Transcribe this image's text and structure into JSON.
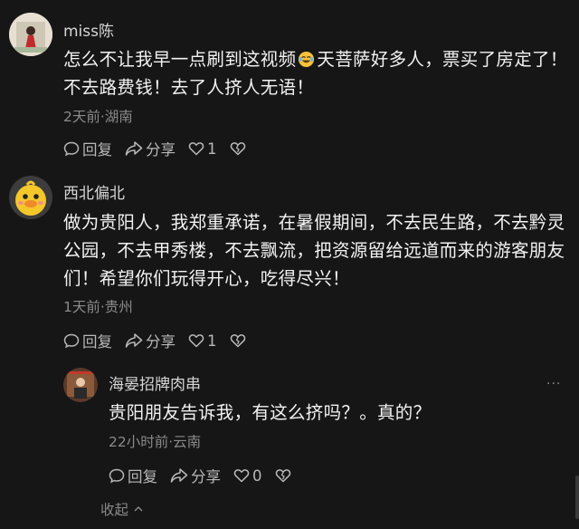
{
  "comments": [
    {
      "user": "miss陈",
      "text_part1": "怎么不让我早一点刷到这视频",
      "emoji": "laughing-crying-emoji",
      "text_part2": "天菩萨好多人，票买了房定了！不去路费钱！去了人挤人无语！",
      "meta": "2天前·湖南",
      "reply_label": "回复",
      "share_label": "分享",
      "likes": "1"
    },
    {
      "user": "西北偏北",
      "text": "做为贵阳人，我郑重承诺，在暑假期间，不去民生路，不去黔灵公园，不去甲秀楼，不去飘流，把资源留给远道而来的游客朋友们！希望你们玩得开心，吃得尽兴！",
      "meta": "1天前·贵州",
      "reply_label": "回复",
      "share_label": "分享",
      "likes": "1"
    }
  ],
  "reply": {
    "user": "海晏招牌肉串",
    "text": "贵阳朋友告诉我，有这么挤吗？。真的？",
    "meta": "22小时前·云南",
    "reply_label": "回复",
    "share_label": "分享",
    "likes": "0",
    "more": "···"
  },
  "collapse_label": "收起",
  "colors": {
    "background": "#161616",
    "text": "#f2f2f2",
    "meta": "#8a8a8a"
  }
}
